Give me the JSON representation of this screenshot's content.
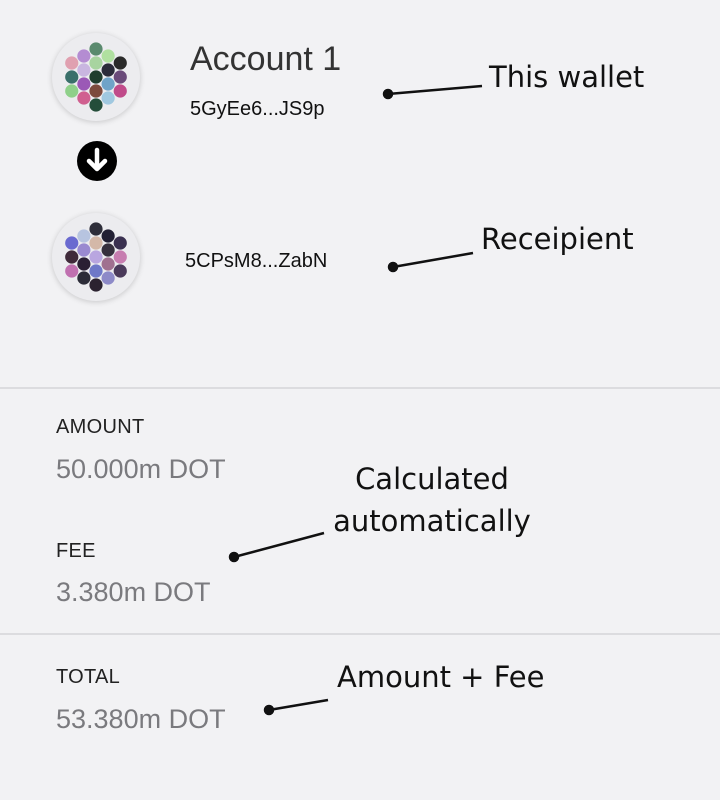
{
  "sender": {
    "name": "Account 1",
    "address": "5GyEe6...JS9p",
    "avatar_colors": [
      "#1f3d2e",
      "#a8d4a0",
      "#c9b6e0",
      "#9b59b6",
      "#7c4a3d",
      "#6fa3c8",
      "#2b2b3a",
      "#5a8a6e",
      "#b48cd2",
      "#e0a0b0",
      "#3a6f6a",
      "#8fd08a",
      "#d06090",
      "#244d3a",
      "#a0c8e0",
      "#c04a8a",
      "#6a4a7a",
      "#2a2a2a",
      "#b0e0a0"
    ]
  },
  "transfer_icon": "arrow-down-icon",
  "recipient": {
    "address": "5CPsM8...ZabN",
    "avatar_colors": [
      "#b9a6e0",
      "#d4b8a8",
      "#9a8ad0",
      "#2a1f33",
      "#6e78c8",
      "#a07090",
      "#36303e",
      "#2e2e3a",
      "#b7c4e0",
      "#6a6ad0",
      "#3f2a3a",
      "#c070b0",
      "#2c2c38",
      "#2b2230",
      "#8d8ac8",
      "#4a3a5a",
      "#c77db0",
      "#3a3050",
      "#222034"
    ]
  },
  "fields": {
    "amount_label": "AMOUNT",
    "amount_value": "50.000m DOT",
    "fee_label": "FEE",
    "fee_value": "3.380m DOT",
    "total_label": "TOTAL",
    "total_value": "53.380m DOT"
  },
  "annotations": {
    "this_wallet": "This wallet",
    "recipient": "Receipient",
    "calculated_line1": "Calculated",
    "calculated_line2": "automatically",
    "total_note": "Amount + Fee"
  }
}
